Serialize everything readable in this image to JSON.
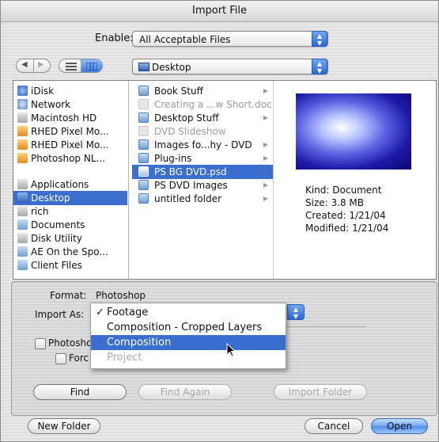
{
  "window": {
    "title": "Import File"
  },
  "enable": {
    "label": "Enable:",
    "value": "All Acceptable Files"
  },
  "nav": {
    "back_icon": "back-arrow-icon",
    "forward_icon": "forward-arrow-icon",
    "list_view_icon": "list-view-icon",
    "column_view_icon": "column-view-icon"
  },
  "location": {
    "value": "Desktop"
  },
  "sidebar": {
    "items": [
      {
        "label": "iDisk",
        "icon": "idisk-icon"
      },
      {
        "label": "Network",
        "icon": "network-icon"
      },
      {
        "label": "Macintosh HD",
        "icon": "hard-disk-icon"
      },
      {
        "label": "RHED Pixel Mo...",
        "icon": "disk-icon"
      },
      {
        "label": "RHED Pixel Mo...",
        "icon": "disk-icon"
      },
      {
        "label": "Photoshop NL...",
        "icon": "disk-icon"
      },
      {
        "label": "Applications",
        "icon": "applications-icon"
      },
      {
        "label": "Desktop",
        "icon": "desktop-icon",
        "selected": true
      },
      {
        "label": "rich",
        "icon": "home-icon"
      },
      {
        "label": "Documents",
        "icon": "documents-icon"
      },
      {
        "label": "Disk Utility",
        "icon": "disk-utility-icon"
      },
      {
        "label": "AE On the Spo...",
        "icon": "folder-icon"
      },
      {
        "label": "Client Files",
        "icon": "folder-icon"
      }
    ]
  },
  "files": {
    "items": [
      {
        "label": "Book Stuff",
        "dim": false,
        "arrow": true
      },
      {
        "label": "Creating a ...w Short.doc",
        "dim": true,
        "arrow": false
      },
      {
        "label": "Desktop Stuff",
        "dim": false,
        "arrow": true
      },
      {
        "label": "DVD Slideshow",
        "dim": true,
        "arrow": false
      },
      {
        "label": "Images fo...hy - DVD",
        "dim": false,
        "arrow": true
      },
      {
        "label": "Plug-ins",
        "dim": false,
        "arrow": true
      },
      {
        "label": "PS BG DVD.psd",
        "dim": false,
        "arrow": false,
        "selected": true
      },
      {
        "label": "PS DVD Images",
        "dim": false,
        "arrow": true
      },
      {
        "label": "untitled folder",
        "dim": false,
        "arrow": true
      }
    ]
  },
  "preview": {
    "kind": "Kind: Document",
    "size": "Size: 3.8 MB",
    "created": "Created: 1/21/04",
    "modified": "Modified: 1/21/04"
  },
  "format": {
    "label": "Format:",
    "value": "Photoshop"
  },
  "import_as": {
    "label": "Import As:",
    "options": [
      {
        "label": "Footage",
        "checked": true,
        "highlighted": false,
        "disabled": false
      },
      {
        "label": "Composition - Cropped Layers",
        "checked": false,
        "highlighted": false,
        "disabled": false
      },
      {
        "label": "Composition",
        "checked": false,
        "highlighted": true,
        "disabled": false
      },
      {
        "label": "Project",
        "checked": false,
        "highlighted": false,
        "disabled": true
      }
    ],
    "check_glyph": "✓"
  },
  "checkboxes": {
    "photoshop_sequence": "Photosho",
    "force_alphabetical": "Forc"
  },
  "buttons": {
    "find": "Find",
    "find_again": "Find Again",
    "import_folder": "Import Folder",
    "new_folder": "New Folder",
    "cancel": "Cancel",
    "open": "Open"
  }
}
